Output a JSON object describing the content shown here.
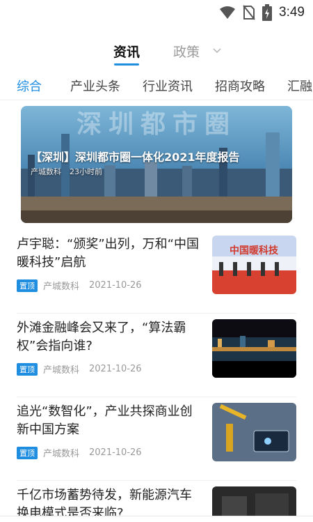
{
  "status_bar": {
    "time": "3:49",
    "icons": [
      "wifi-icon",
      "no-sim-icon",
      "battery-charging-icon"
    ]
  },
  "top_tabs": [
    {
      "label": "资讯",
      "active": true
    },
    {
      "label": "政策",
      "active": false
    }
  ],
  "category_tabs": [
    {
      "label": "综合",
      "active": true
    },
    {
      "label": "产业头条",
      "active": false
    },
    {
      "label": "行业资讯",
      "active": false
    },
    {
      "label": "招商攻略",
      "active": false
    },
    {
      "label": "汇融",
      "active": false
    }
  ],
  "banner": {
    "overlay_text": "深圳都市圈",
    "title": "【深圳】深圳都市圈一体化2021年度报告",
    "source": "产城数科",
    "time": "23小时前"
  },
  "news": [
    {
      "title": "卢宇聪：“颁奖”出列，万和“中国暖科技”启航",
      "badge": "置顶",
      "source": "产城数科",
      "date": "2021-10-26",
      "thumb": "中国暖科技"
    },
    {
      "title": "外滩金融峰会又来了，“算法霸权”会指向谁?",
      "badge": "置顶",
      "source": "产城数科",
      "date": "2021-10-26"
    },
    {
      "title": "追光“数智化”，产业共探商业创新中国方案",
      "badge": "置顶",
      "source": "产城数科",
      "date": "2021-10-26"
    },
    {
      "title": "千亿市场蓄势待发，新能源汽车换电模式是否来临?",
      "source": "",
      "date": ""
    }
  ],
  "colors": {
    "accent": "#1f8ee0"
  }
}
